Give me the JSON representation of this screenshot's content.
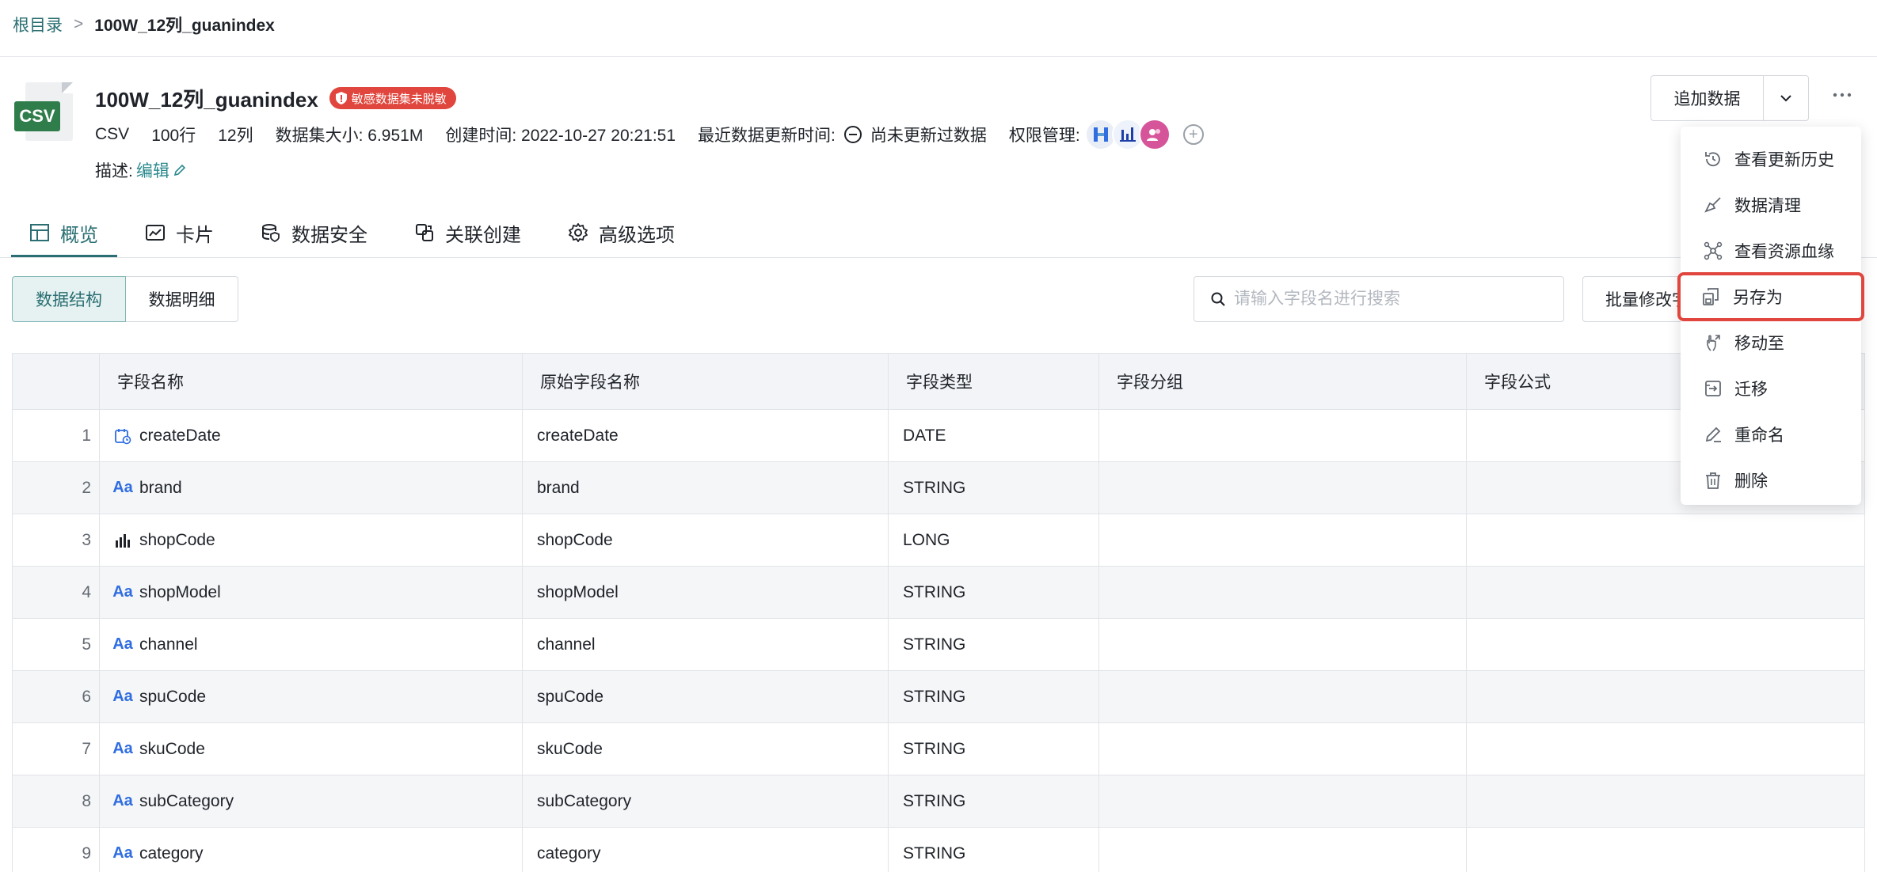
{
  "breadcrumb": {
    "root": "根目录",
    "sep": ">",
    "current": "100W_12列_guanindex"
  },
  "dataset": {
    "file_type": "CSV",
    "title": "100W_12列_guanindex",
    "sensitive_badge": "敏感数据集未脱敏",
    "meta": {
      "format": "CSV",
      "rows": "100行",
      "cols": "12列",
      "size_label": "数据集大小:",
      "size": "6.951M",
      "created_label": "创建时间:",
      "created": "2022-10-27 20:21:51",
      "updated_label": "最近数据更新时间:",
      "updated": "尚未更新过数据",
      "perm_label": "权限管理:"
    },
    "desc_label": "描述:",
    "desc_edit": "编辑"
  },
  "header_actions": {
    "append": "追加数据"
  },
  "tabs": [
    {
      "label": "概览",
      "icon": "table-icon"
    },
    {
      "label": "卡片",
      "icon": "chart-card-icon"
    },
    {
      "label": "数据安全",
      "icon": "database-shield-icon"
    },
    {
      "label": "关联创建",
      "icon": "link-icon"
    },
    {
      "label": "高级选项",
      "icon": "gear-icon"
    }
  ],
  "view_toggle": {
    "structure": "数据结构",
    "detail": "数据明细"
  },
  "search": {
    "placeholder": "请输入字段名进行搜索"
  },
  "batch_button": "批量修改字段",
  "table": {
    "headers": [
      "",
      "字段名称",
      "原始字段名称",
      "字段类型",
      "字段分组",
      "字段公式"
    ],
    "rows": [
      {
        "idx": "1",
        "icon": "date",
        "name": "createDate",
        "orig": "createDate",
        "type": "DATE"
      },
      {
        "idx": "2",
        "icon": "text",
        "name": "brand",
        "orig": "brand",
        "type": "STRING"
      },
      {
        "idx": "3",
        "icon": "number",
        "name": "shopCode",
        "orig": "shopCode",
        "type": "LONG"
      },
      {
        "idx": "4",
        "icon": "text",
        "name": "shopModel",
        "orig": "shopModel",
        "type": "STRING"
      },
      {
        "idx": "5",
        "icon": "text",
        "name": "channel",
        "orig": "channel",
        "type": "STRING"
      },
      {
        "idx": "6",
        "icon": "text",
        "name": "spuCode",
        "orig": "spuCode",
        "type": "STRING"
      },
      {
        "idx": "7",
        "icon": "text",
        "name": "skuCode",
        "orig": "skuCode",
        "type": "STRING"
      },
      {
        "idx": "8",
        "icon": "text",
        "name": "subCategory",
        "orig": "subCategory",
        "type": "STRING"
      },
      {
        "idx": "9",
        "icon": "text",
        "name": "category",
        "orig": "category",
        "type": "STRING"
      }
    ],
    "text_type_glyph": "Aa"
  },
  "more_menu": {
    "items": [
      {
        "label": "查看更新历史",
        "icon": "history-icon"
      },
      {
        "label": "数据清理",
        "icon": "broom-icon"
      },
      {
        "label": "查看资源血缘",
        "icon": "lineage-icon"
      },
      {
        "label": "另存为",
        "icon": "save-as-icon",
        "highlighted": true
      },
      {
        "label": "移动至",
        "icon": "move-icon"
      },
      {
        "label": "迁移",
        "icon": "migrate-icon"
      },
      {
        "label": "重命名",
        "icon": "rename-icon"
      },
      {
        "label": "删除",
        "icon": "trash-icon"
      }
    ]
  },
  "colors": {
    "accent": "#2b6f73",
    "danger": "#e0463d",
    "type_icon": "#2f6de1"
  }
}
